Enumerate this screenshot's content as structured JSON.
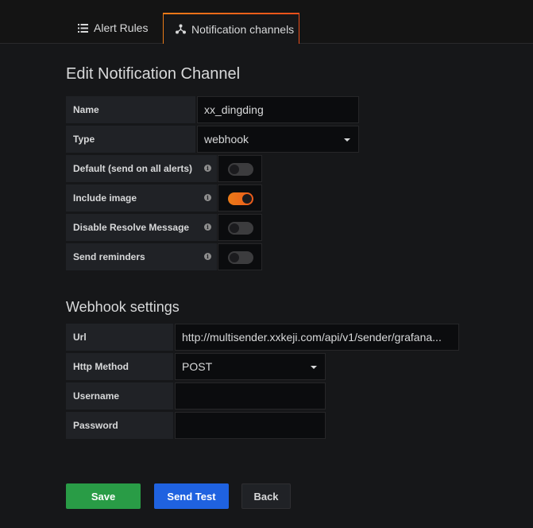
{
  "tabs": [
    {
      "label": "Alert Rules",
      "icon": "list-icon",
      "active": false
    },
    {
      "label": "Notification channels",
      "icon": "channels-icon",
      "active": true
    }
  ],
  "page_title": "Edit Notification Channel",
  "form": {
    "name_label": "Name",
    "name_value": "xx_dingding",
    "type_label": "Type",
    "type_value": "webhook",
    "default_label": "Default (send on all alerts)",
    "default_on": false,
    "include_image_label": "Include image",
    "include_image_on": true,
    "disable_resolve_label": "Disable Resolve Message",
    "disable_resolve_on": false,
    "send_reminders_label": "Send reminders",
    "send_reminders_on": false
  },
  "webhook": {
    "title": "Webhook settings",
    "url_label": "Url",
    "url_value": "http://multisender.xxkeji.com/api/v1/sender/grafana...",
    "method_label": "Http Method",
    "method_value": "POST",
    "username_label": "Username",
    "username_value": "",
    "password_label": "Password",
    "password_value": ""
  },
  "buttons": {
    "save": "Save",
    "send_test": "Send Test",
    "back": "Back"
  },
  "colors": {
    "accent_orange": "#eb7b18",
    "save_green": "#299c46",
    "test_blue": "#1f62e0"
  }
}
